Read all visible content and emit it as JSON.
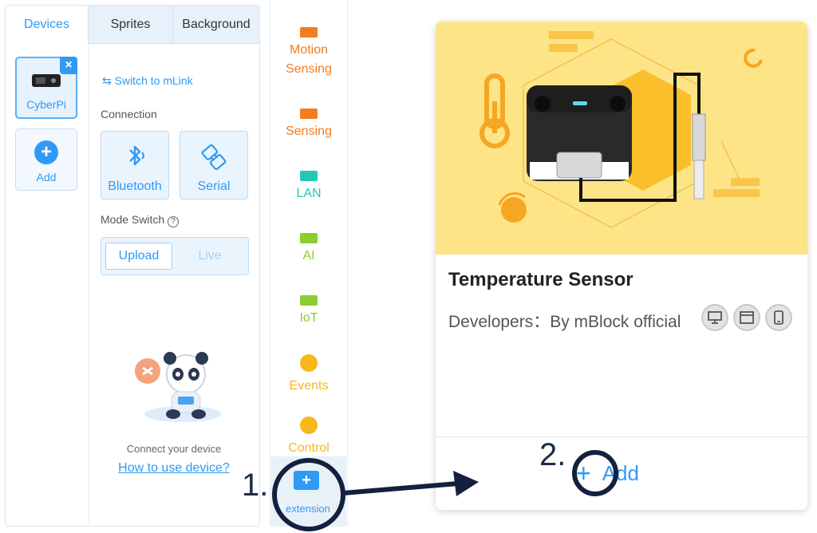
{
  "tabs": [
    {
      "label": "Devices",
      "active": true
    },
    {
      "label": "Sprites",
      "active": false
    },
    {
      "label": "Background",
      "active": false
    }
  ],
  "devices": {
    "selected_label": "CyberPi",
    "add_label": "Add"
  },
  "connection": {
    "switch_link": "Switch to mLink",
    "section_label": "Connection",
    "bluetooth_label": "Bluetooth",
    "serial_label": "Serial",
    "mode_label": "Mode Switch",
    "upload_label": "Upload",
    "live_label": "Live",
    "connect_hint": "Connect your device",
    "help_link": "How to use device?"
  },
  "categories": [
    {
      "label": "Motion Sensing",
      "line1": "Motion",
      "line2": "Sensing",
      "color": "#f47c20",
      "icon": "rect"
    },
    {
      "label": "Sensing",
      "color": "#f47c20",
      "icon": "rect"
    },
    {
      "label": "LAN",
      "color": "#22c7b6",
      "icon": "rect"
    },
    {
      "label": "AI",
      "color": "#8ccd2f",
      "icon": "rect"
    },
    {
      "label": "IoT",
      "color": "#8ccd2f",
      "icon": "rect"
    },
    {
      "label": "Events",
      "color": "#f9b81a",
      "icon": "circle"
    },
    {
      "label": "Control",
      "color": "#f9b81a",
      "icon": "circle"
    }
  ],
  "extension_button": "extension",
  "card": {
    "title": "Temperature Sensor",
    "developers": "Developers：By mBlock official",
    "platform_icons": [
      "desktop-icon",
      "browser-icon",
      "mobile-icon"
    ],
    "add_label": "Add"
  },
  "annotations": {
    "step1": "1.",
    "step2": "2."
  },
  "colors": {
    "accent": "#2f9af6",
    "hero_bg": "#fde487",
    "annotation": "#13213f"
  }
}
